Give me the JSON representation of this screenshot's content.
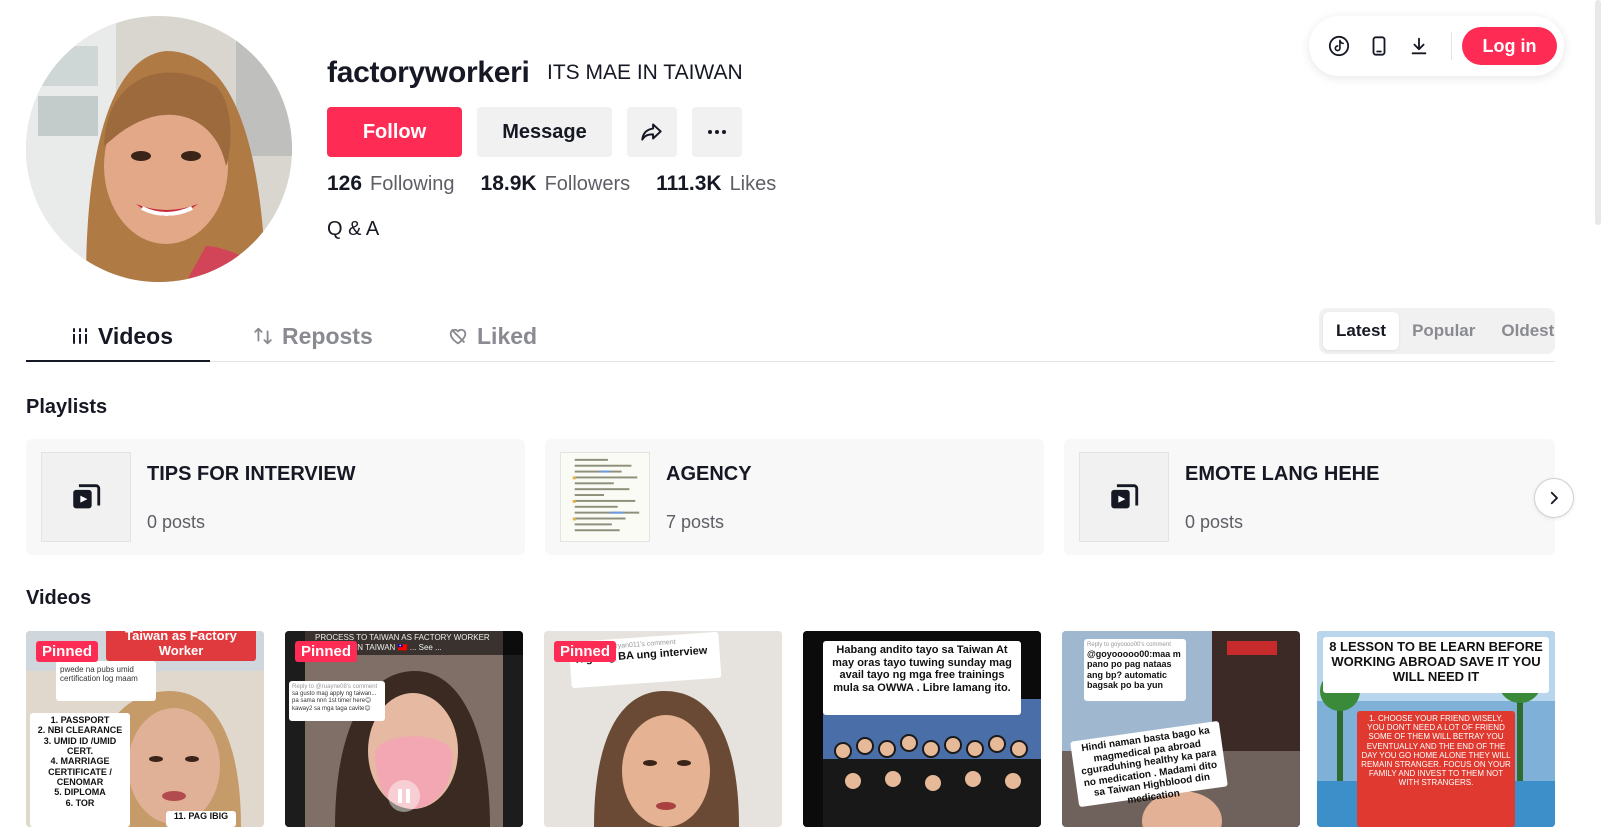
{
  "toolbar": {
    "tiktok_icon": "tiktok-icon",
    "mobile_icon": "mobile-icon",
    "download_icon": "download-icon",
    "login_label": "Log in"
  },
  "profile": {
    "username": "factoryworkeri",
    "nickname": "ITS MAE IN TAIWAN",
    "follow_label": "Follow",
    "message_label": "Message",
    "bio": "Q & A",
    "stats": [
      {
        "value": "126",
        "label": "Following"
      },
      {
        "value": "18.9K",
        "label": "Followers"
      },
      {
        "value": "111.3K",
        "label": "Likes"
      }
    ]
  },
  "tabs": [
    {
      "label": "Videos",
      "active": true
    },
    {
      "label": "Reposts",
      "active": false
    },
    {
      "label": "Liked",
      "active": false
    }
  ],
  "sort": [
    {
      "label": "Latest",
      "active": true
    },
    {
      "label": "Popular",
      "active": false
    },
    {
      "label": "Oldest",
      "active": false
    }
  ],
  "sections": {
    "playlists_title": "Playlists",
    "videos_title": "Videos"
  },
  "playlists": [
    {
      "name": "TIPS FOR INTERVIEW",
      "count": "0 posts"
    },
    {
      "name": "AGENCY",
      "count": "7 posts"
    },
    {
      "name": "EMOTE LANG HEHE",
      "count": "0 posts"
    }
  ],
  "videos": [
    {
      "pinned": "Pinned",
      "header": "Taiwan as Factory Worker",
      "comment": "pwede na pubs umid certification log maam",
      "list": "1. PASSPORT\n2. NBI CLEARANCE\n3. UMID ID /UMID CERT.\n4. MARRIAGE CERTIFICATE / CENOMAR\n5. DIPLOMA\n6. TOR",
      "extra": "11. PAG IBIG"
    },
    {
      "pinned": "Pinned",
      "header": "PROCESS TO TAIWAN AS FACTORY WORKER",
      "header2": "TO APPLY IN TAIWAN 🇹🇼 ... See ...",
      "reply": "Reply to @ruayne08's comment",
      "comment": "sa gusto mag apply ng taiwan... pa sama nnn 1st timer here😊 kaway2 sa mga taga cavite😊"
    },
    {
      "pinned": "Pinned",
      "reply": "Reply to kimbryan011's comment",
      "comment": "Tagalog BA ung interview"
    },
    {
      "caption": "Habang andito tayo sa Taiwan At may oras tayo tuwing sunday mag avail tayo ng mga free trainings mula sa OWWA . Libre lamang ito."
    },
    {
      "reply": "Reply to goyoooo00's comment",
      "comment": "@goyooooo00:maa m pano po pag nataas ang bp? automatic bagsak po ba yun",
      "caption": "Hindi naman basta bago ka magmedical pa abroad cguraduhing healthy ka para no medication . Madami dito sa Taiwan Highblood din medication"
    },
    {
      "title": "8 LESSON TO BE LEARN BEFORE WORKING ABROAD SAVE IT YOU WILL NEED IT",
      "body": "1. CHOOSE YOUR FRIEND WISELY, YOU DON'T NEED A LOT OF FRIEND SOME OF THEM WILL BETRAY YOU EVENTUALLY AND THE END OF THE DAY YOU GO HOME ALONE THEY WILL REMAIN STRANGER. FOCUS ON YOUR FAMILY AND INVEST TO THEM NOT WITH STRANGERS."
    }
  ],
  "colors": {
    "accent": "#fe2c55",
    "text": "#161823",
    "muted": "#8a8b91",
    "surface": "#f1f1f2"
  }
}
